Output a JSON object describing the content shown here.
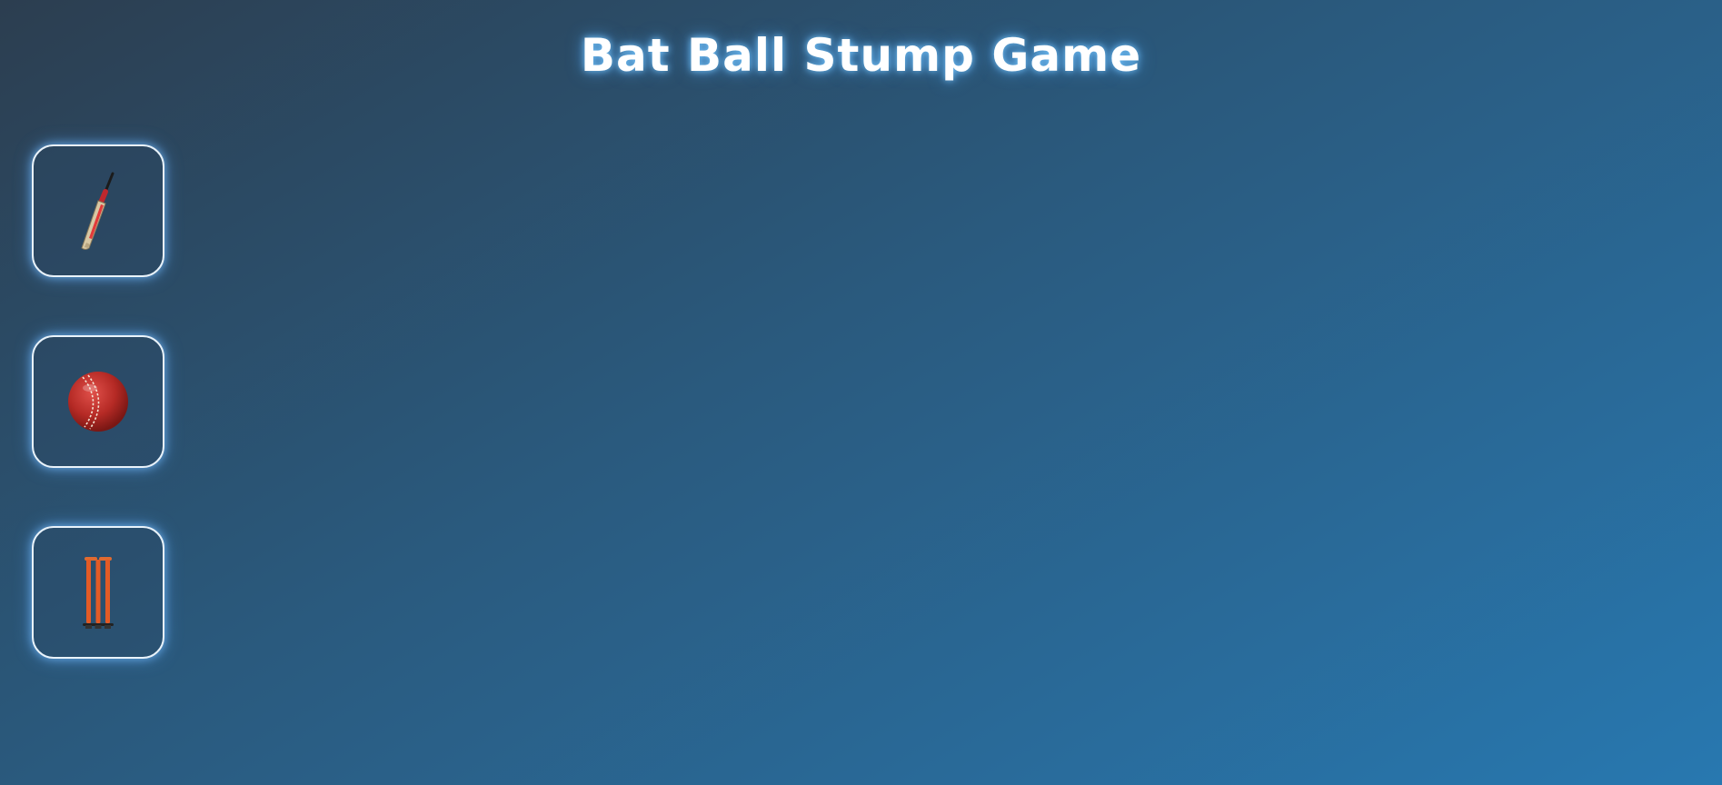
{
  "header": {
    "title": "Bat Ball Stump Game"
  },
  "choices": [
    {
      "id": "bat",
      "icon": "cricket-bat-icon"
    },
    {
      "id": "ball",
      "icon": "cricket-ball-icon"
    },
    {
      "id": "stump",
      "icon": "cricket-stumps-icon"
    }
  ],
  "colors": {
    "background_start": "#2c3e50",
    "background_end": "#2878b0",
    "button_border": "#e9f3fb",
    "glow": "#78beff",
    "title_text": "#ffffff"
  }
}
